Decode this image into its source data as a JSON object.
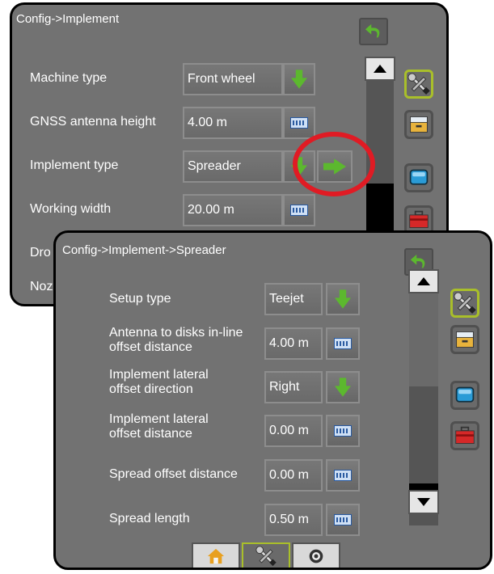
{
  "back_panel": {
    "title": "Config->Implement",
    "rows": [
      {
        "label": "Machine type",
        "value": "Front wheel"
      },
      {
        "label": "GNSS antenna height",
        "value": "4.00 m"
      },
      {
        "label": "Implement type",
        "value": "Spreader"
      },
      {
        "label": "Working width",
        "value": "20.00 m"
      },
      {
        "label": "Dro",
        "value": ""
      },
      {
        "label": "Noz",
        "value": ""
      }
    ]
  },
  "front_panel": {
    "title": "Config->Implement->Spreader",
    "rows": [
      {
        "label": "Setup type",
        "value": "Teejet"
      },
      {
        "label": "Antenna to disks in-line offset distance",
        "value": "4.00 m"
      },
      {
        "label": "Implement lateral offset direction",
        "value": "Right"
      },
      {
        "label": "Implement lateral offset distance",
        "value": "0.00 m"
      },
      {
        "label": "Spread offset distance",
        "value": "0.00 m"
      },
      {
        "label": "Spread length",
        "value": "0.50 m"
      }
    ]
  },
  "colors": {
    "panel_bg": "#727272",
    "highlight_circle": "#e01b24",
    "active_accent": "#a9bf2a",
    "arrow_green": "#5cb82e"
  },
  "icons": {
    "back": "back-arrow-icon",
    "tools": "wrench-screwdriver-icon",
    "data": "file-box-icon",
    "display": "monitor-icon",
    "console": "toolbox-icon",
    "home": "home-icon",
    "gnss": "satellite-icon",
    "dropdown": "green-down-arrow-icon",
    "keyboard": "keyboard-icon",
    "next": "green-right-arrow-icon"
  }
}
